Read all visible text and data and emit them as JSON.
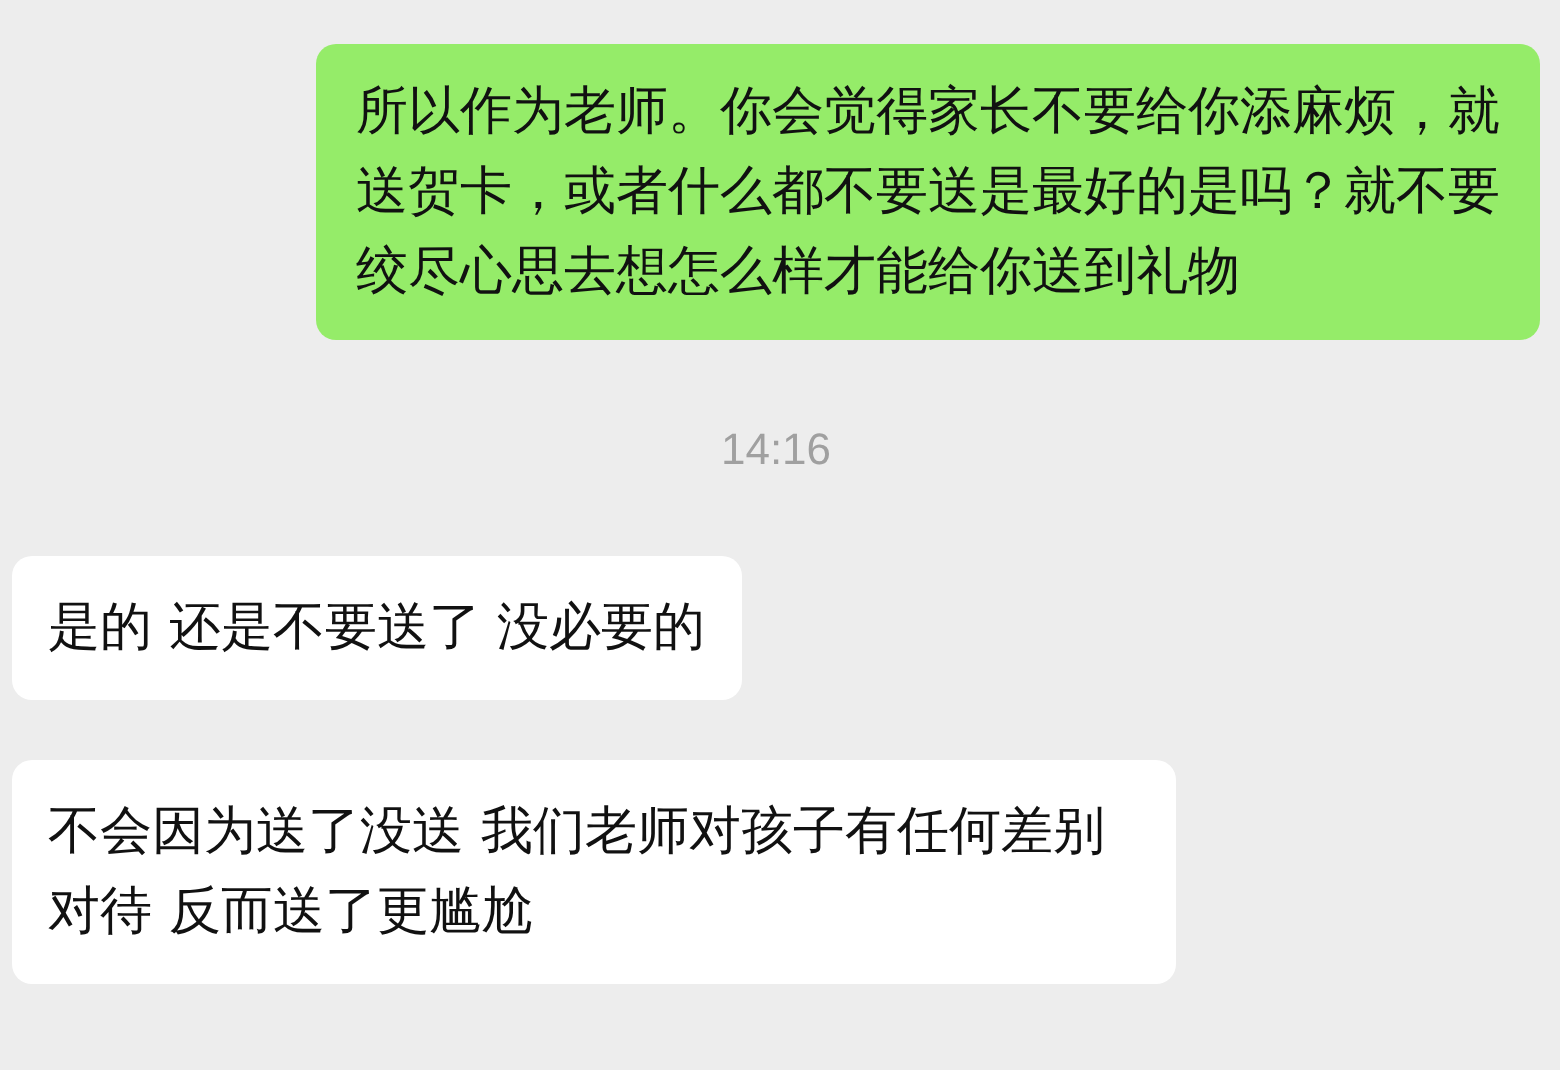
{
  "messages": [
    {
      "kind": "sent",
      "text": "所以作为老师。你会觉得家长不要给你添麻烦，就送贺卡，或者什么都不要送是最好的是吗？就不要绞尽心思去想怎么样才能给你送到礼物"
    },
    {
      "kind": "time",
      "text": "14:16"
    },
    {
      "kind": "received",
      "text": "是的 还是不要送了 没必要的"
    },
    {
      "kind": "received",
      "text": "不会因为送了没送 我们老师对孩子有任何差别对待 反而送了更尴尬"
    }
  ]
}
